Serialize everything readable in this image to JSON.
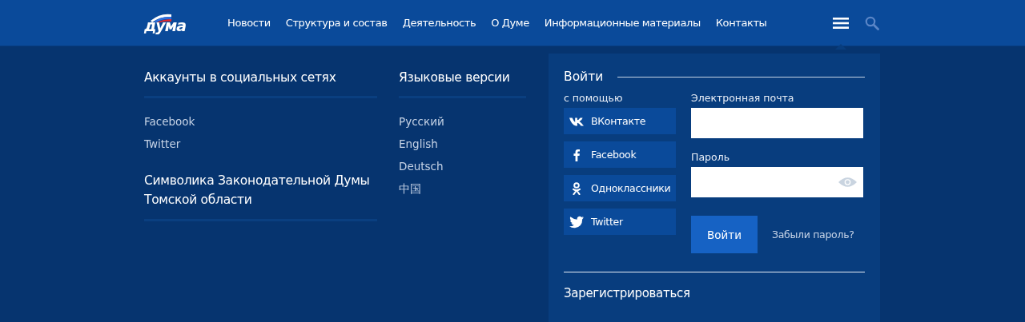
{
  "header": {
    "logo_text": "дума",
    "nav": [
      {
        "label": "Новости"
      },
      {
        "label": "Структура и состав"
      },
      {
        "label": "Деятельность"
      },
      {
        "label": "О Думе"
      },
      {
        "label": "Информационные материалы"
      },
      {
        "label": "Контакты"
      }
    ],
    "menu_open": true
  },
  "social": {
    "title": "Аккаунты в социальных сетях",
    "links": [
      "Facebook",
      "Twitter"
    ]
  },
  "symbols": {
    "title": "Символика Законодательной Думы Томской области"
  },
  "languages": {
    "title": "Языковые версии",
    "items": [
      "Русский",
      "English",
      "Deutsch",
      "中国"
    ]
  },
  "login": {
    "title": "Войти",
    "via_label": "с помощью",
    "providers": [
      {
        "kind": "vk",
        "label": "ВКонтакте"
      },
      {
        "kind": "facebook",
        "label": "Facebook"
      },
      {
        "kind": "ok",
        "label": "Одноклассники"
      },
      {
        "kind": "twitter",
        "label": "Twitter"
      }
    ],
    "email_label": "Электронная почта",
    "password_label": "Пароль",
    "submit": "Войти",
    "forgot": "Забыли пароль?",
    "register": "Зарегистрироваться"
  }
}
